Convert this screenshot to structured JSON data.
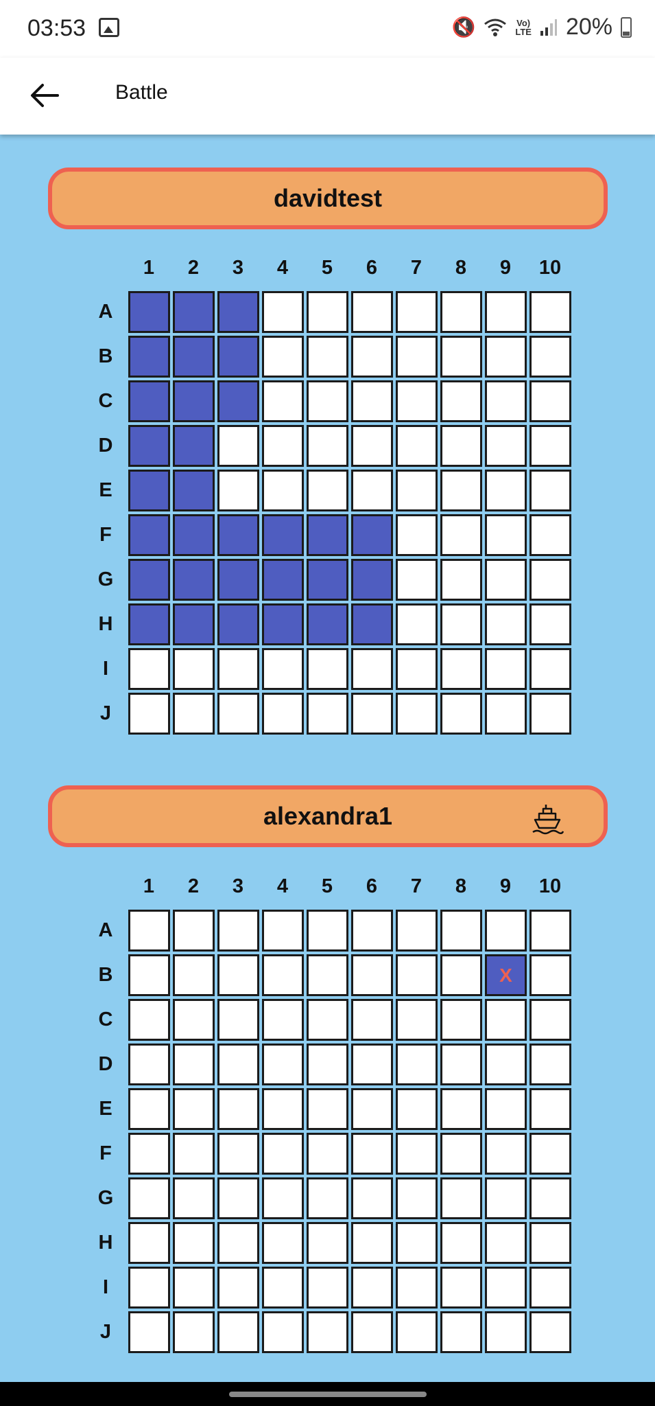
{
  "status": {
    "time": "03:53",
    "battery": "20%",
    "volte": [
      "Vo)",
      "LTE"
    ]
  },
  "app_bar": {
    "title": "Battle",
    "back_icon": "arrow-left-icon"
  },
  "columns": [
    "1",
    "2",
    "3",
    "4",
    "5",
    "6",
    "7",
    "8",
    "9",
    "10"
  ],
  "rows": [
    "A",
    "B",
    "C",
    "D",
    "E",
    "F",
    "G",
    "H",
    "I",
    "J"
  ],
  "boards": [
    {
      "player": "davidtest",
      "show_ship_icon": false,
      "cells": [
        "SSS.......",
        "SSS.......",
        "SSS.......",
        "SS........",
        "SS........",
        "SSSSSS....",
        "SSSSSS....",
        "SSSSSS....",
        "..........",
        ".........."
      ]
    },
    {
      "player": "alexandra1",
      "show_ship_icon": true,
      "ship_icon": "ship-icon",
      "hit_mark": "X",
      "cells": [
        "..........",
        "........X.",
        "..........",
        "..........",
        "..........",
        "..........",
        "..........",
        "..........",
        "..........",
        ".........."
      ]
    }
  ],
  "colors": {
    "background": "#8ECDF0",
    "banner_fill": "#F1A765",
    "banner_border": "#EE6151",
    "ship_cell": "#4F5DC0",
    "empty_cell": "#FFFFFF",
    "hit_mark": "#EE6151"
  }
}
